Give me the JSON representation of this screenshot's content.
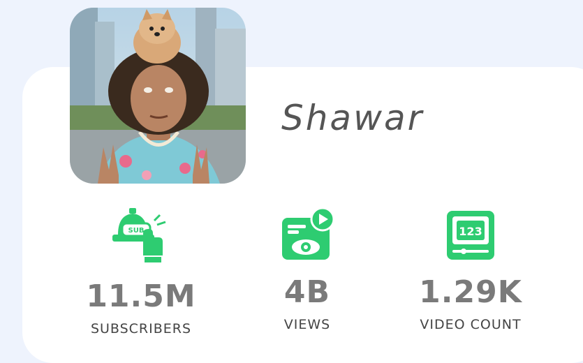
{
  "profile": {
    "name": "Shawar",
    "avatar_icon": "profile-photo"
  },
  "stats": [
    {
      "value": "11.5M",
      "label": "SUBSCRIBERS",
      "icon": "subscribe-bell-icon"
    },
    {
      "value": "4B",
      "label": "VIEWS",
      "icon": "video-views-icon"
    },
    {
      "value": "1.29K",
      "label": "VIDEO COUNT",
      "icon": "video-count-icon"
    }
  ],
  "colors": {
    "accent": "#2ecc71",
    "background": "#eef3fd",
    "card": "#ffffff",
    "value_text": "#7a7a7a"
  }
}
